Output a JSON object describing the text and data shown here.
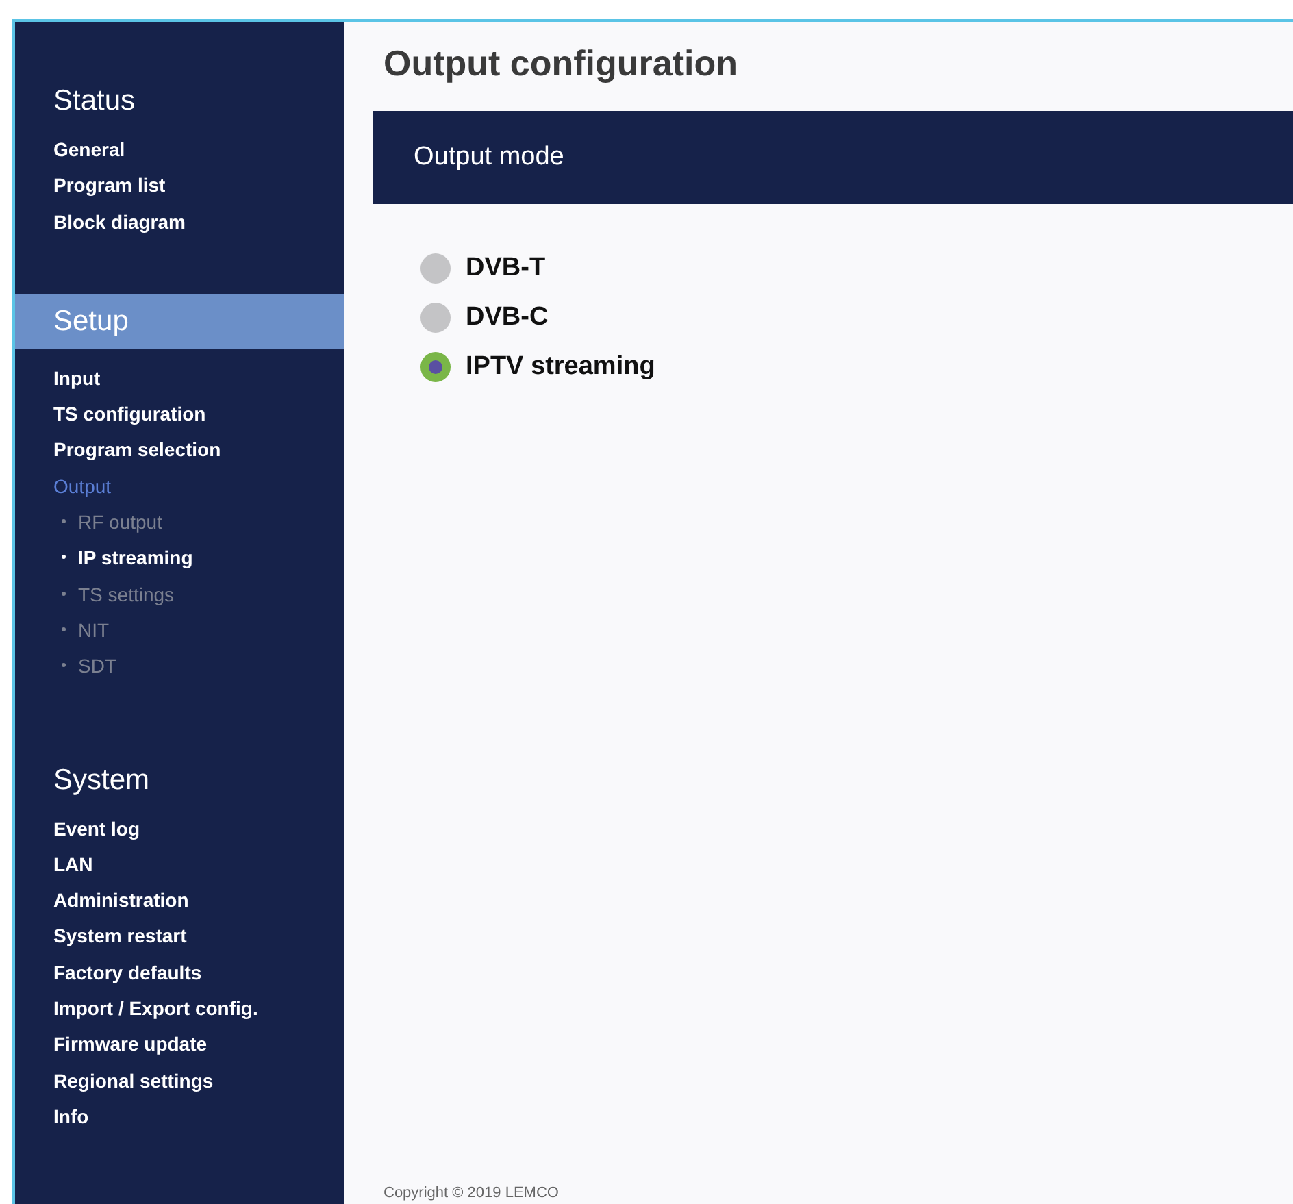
{
  "sidebar": {
    "sections": [
      {
        "heading": "Status",
        "selected": false,
        "items": [
          {
            "label": "General",
            "selected": false
          },
          {
            "label": "Program list",
            "selected": false
          },
          {
            "label": "Block diagram",
            "selected": false
          }
        ]
      },
      {
        "heading": "Setup",
        "selected": true,
        "items": [
          {
            "label": "Input",
            "selected": false
          },
          {
            "label": "TS configuration",
            "selected": false
          },
          {
            "label": "Program selection",
            "selected": false
          },
          {
            "label": "Output",
            "selected": true,
            "children": [
              {
                "label": "RF output",
                "selected": false
              },
              {
                "label": "IP streaming",
                "selected": true
              },
              {
                "label": "TS settings",
                "selected": false
              },
              {
                "label": "NIT",
                "selected": false
              },
              {
                "label": "SDT",
                "selected": false
              }
            ]
          }
        ]
      },
      {
        "heading": "System",
        "selected": false,
        "items": [
          {
            "label": "Event log",
            "selected": false
          },
          {
            "label": "LAN",
            "selected": false
          },
          {
            "label": "Administration",
            "selected": false
          },
          {
            "label": "System restart",
            "selected": false
          },
          {
            "label": "Factory defaults",
            "selected": false
          },
          {
            "label": "Import / Export config.",
            "selected": false
          },
          {
            "label": "Firmware update",
            "selected": false
          },
          {
            "label": "Regional settings",
            "selected": false
          },
          {
            "label": "Info",
            "selected": false
          }
        ]
      }
    ]
  },
  "page_title": "Output configuration",
  "panel": {
    "title": "Output mode",
    "options": [
      {
        "label": "DVB-T",
        "selected": false
      },
      {
        "label": "DVB-C",
        "selected": false
      },
      {
        "label": "IPTV streaming",
        "selected": true
      }
    ]
  },
  "footer": "Copyright © 2019 LEMCO"
}
